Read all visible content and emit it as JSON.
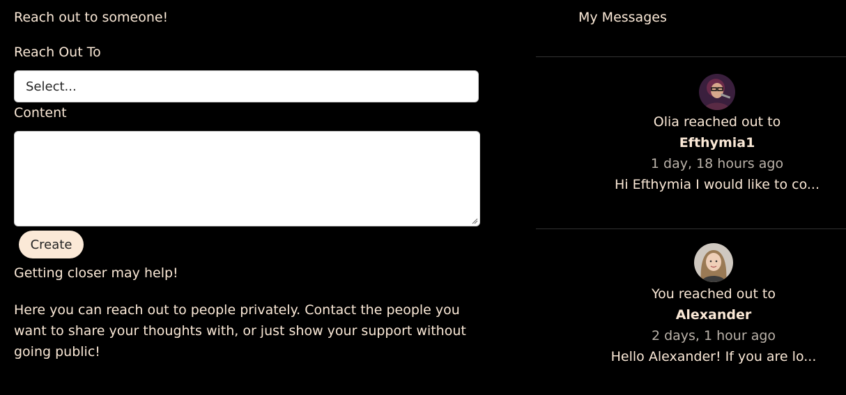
{
  "compose": {
    "title": "Reach out to someone!",
    "reach_label": "Reach Out To",
    "select_value": "Select...",
    "content_label": "Content",
    "content_value": "",
    "create_label": "Create",
    "subheading": "Getting closer may help!",
    "description": "Here you can reach out to people privately. Contact the people you want to share your thoughts with, or just show your support without going public!"
  },
  "messages": {
    "title": "My Messages",
    "items": [
      {
        "line": "Olia reached out to",
        "name": "Efthymia1",
        "time": "1 day, 18 hours ago",
        "preview": "Hi Efthymia I would like to co..."
      },
      {
        "line": "You reached out to",
        "name": "Alexander",
        "time": "2 days, 1 hour ago",
        "preview": "Hello Alexander! If you are lo..."
      }
    ]
  },
  "colors": {
    "background": "#000000",
    "text": "#fbe9d7",
    "button_bg": "#fbe9d7"
  }
}
